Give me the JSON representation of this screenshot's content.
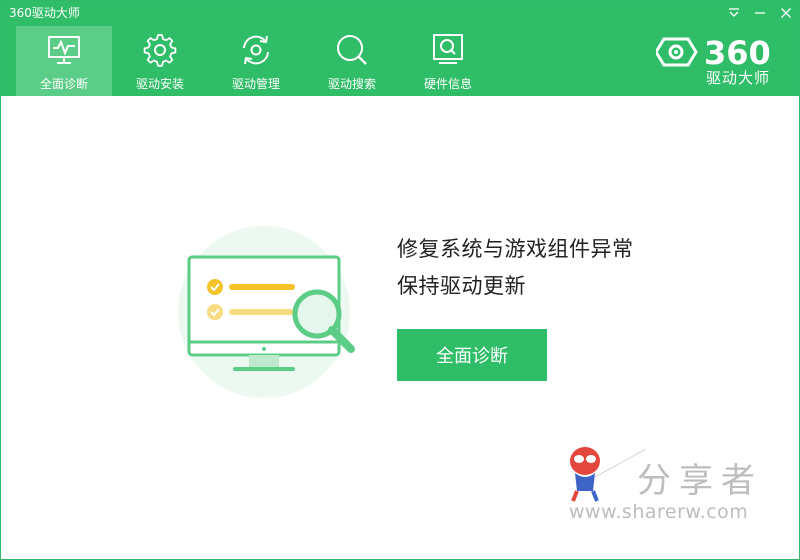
{
  "app": {
    "title": "360驱动大师"
  },
  "window_controls": [
    {
      "name": "menu",
      "icon": "dropdown-menu-icon"
    },
    {
      "name": "minimize",
      "icon": "minimize-icon"
    },
    {
      "name": "close",
      "icon": "close-icon"
    }
  ],
  "nav": {
    "tabs": [
      {
        "label": "全面诊断",
        "icon": "monitor-pulse-icon",
        "active": true
      },
      {
        "label": "驱动安装",
        "icon": "gear-icon",
        "active": false
      },
      {
        "label": "驱动管理",
        "icon": "refresh-gear-icon",
        "active": false
      },
      {
        "label": "驱动搜索",
        "icon": "search-icon",
        "active": false
      },
      {
        "label": "硬件信息",
        "icon": "monitor-search-icon",
        "active": false
      }
    ]
  },
  "brand": {
    "number": "360",
    "name": "驱动大师",
    "icon": "360-logo-icon"
  },
  "main": {
    "headline_line1": "修复系统与游戏组件异常",
    "headline_line2": "保持驱动更新",
    "scan_button": "全面诊断",
    "illustration": "monitor-checklist-magnifier-illustration"
  },
  "watermark": {
    "text": "分享者",
    "url": "www.sharerw.com",
    "icon": "spider-mascot-icon"
  },
  "colors": {
    "header_green": "#2fbd67",
    "active_tab": "#5ccd87",
    "button_green": "#2fbd67",
    "check_yellow": "#f5c327",
    "illustration_green": "#5ccd87"
  }
}
